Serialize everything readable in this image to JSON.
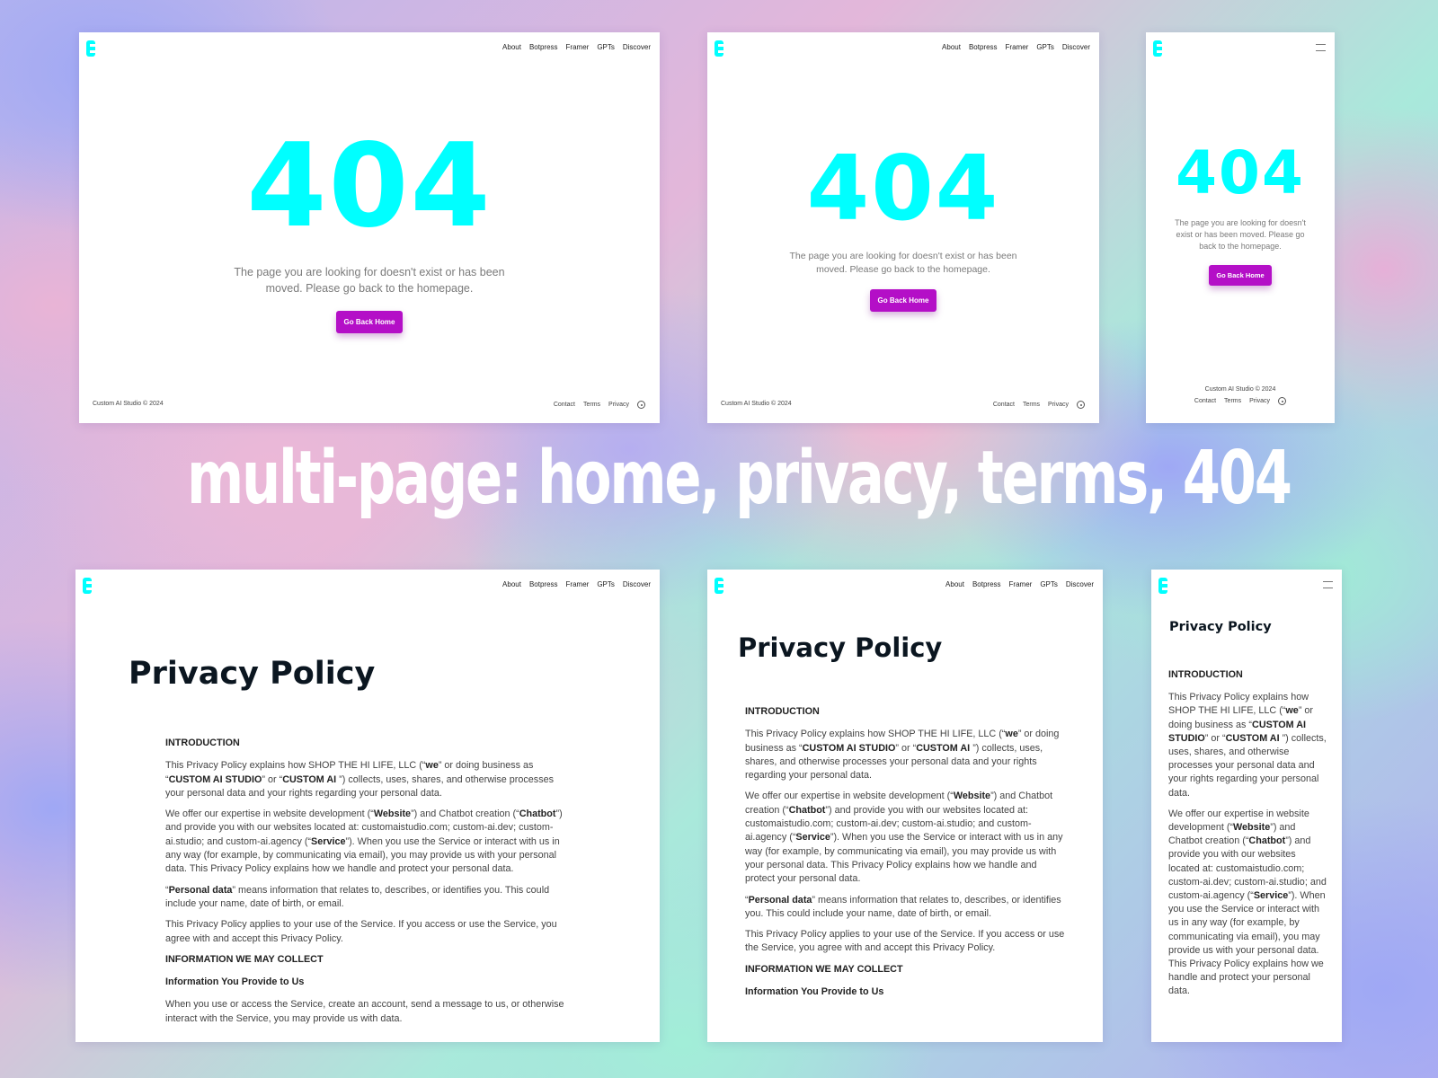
{
  "brand": {
    "accent_cyan": "#00ffff",
    "button_color": "#b40fc7"
  },
  "nav": {
    "links": [
      "About",
      "Botpress",
      "Framer",
      "GPTs",
      "Discover"
    ]
  },
  "page404": {
    "code": "404",
    "message": "The page you are looking for doesn't exist or has been moved. Please go back to the homepage.",
    "button_label": "Go Back Home"
  },
  "footer": {
    "copyright": "Custom AI Studio © 2024",
    "links": [
      "Contact",
      "Terms",
      "Privacy"
    ]
  },
  "banner": {
    "text": "multi-page: home, privacy, terms, 404"
  },
  "privacy": {
    "title": "Privacy Policy",
    "intro_heading": "INTRODUCTION",
    "p1_pre": "This Privacy Policy explains how SHOP THE HI LIFE, LLC (“",
    "p1_we": "we",
    "p1_mid1": "” or doing business as “",
    "p1_studio": "CUSTOM AI STUDIO",
    "p1_mid2": "” or “",
    "p1_ai": "CUSTOM AI ",
    "p1_post": "”) collects, uses, shares, and otherwise processes your personal data and your rights regarding your personal data.",
    "p2_pre": "We offer our expertise in website development (“",
    "p2_website": "Website",
    "p2_mid1": "”) and Chatbot creation (“",
    "p2_chatbot": "Chatbot",
    "p2_mid2": "”) and provide you with our websites located at: customaistudio.com; custom-ai.dev; custom-ai.studio; and custom-ai.agency (“",
    "p2_service": "Service",
    "p2_post": "”). When you use the Service or interact with us in any way (for example, by communicating via email), you may provide us with your personal data. This Privacy Policy explains how we handle and protect your personal data.",
    "p3_pre": "“",
    "p3_bold": "Personal data",
    "p3_post": "” means information that relates to, describes, or identifies you. This could include your name, date of birth, or email.",
    "p4": "This Privacy Policy applies to your use of the Service. If you access or use the Service, you agree with and accept this Privacy Policy.",
    "collect_heading": "INFORMATION WE MAY COLLECT",
    "provide_heading": "Information You Provide to Us",
    "p5": "When you use or access the Service, create an account, send a message to us, or otherwise interact with the Service, you may provide us with data."
  }
}
